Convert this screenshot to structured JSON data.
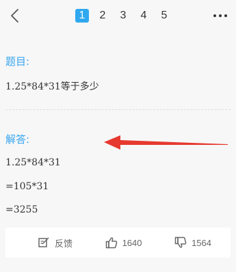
{
  "header": {
    "pages": [
      "1",
      "2",
      "3",
      "4",
      "5"
    ],
    "active_page": "1"
  },
  "question": {
    "label": "题目:",
    "text": "1.25*84*31等于多少"
  },
  "answer": {
    "label": "解答:",
    "lines": [
      "1.25*84*31",
      "=105*31",
      "=3255"
    ]
  },
  "footer": {
    "feedback_label": "反馈",
    "like_count": "1640",
    "dislike_count": "1564"
  },
  "colors": {
    "accent": "#2fa8f0",
    "section_title": "#39a6f0",
    "arrow": "#e6392f"
  }
}
